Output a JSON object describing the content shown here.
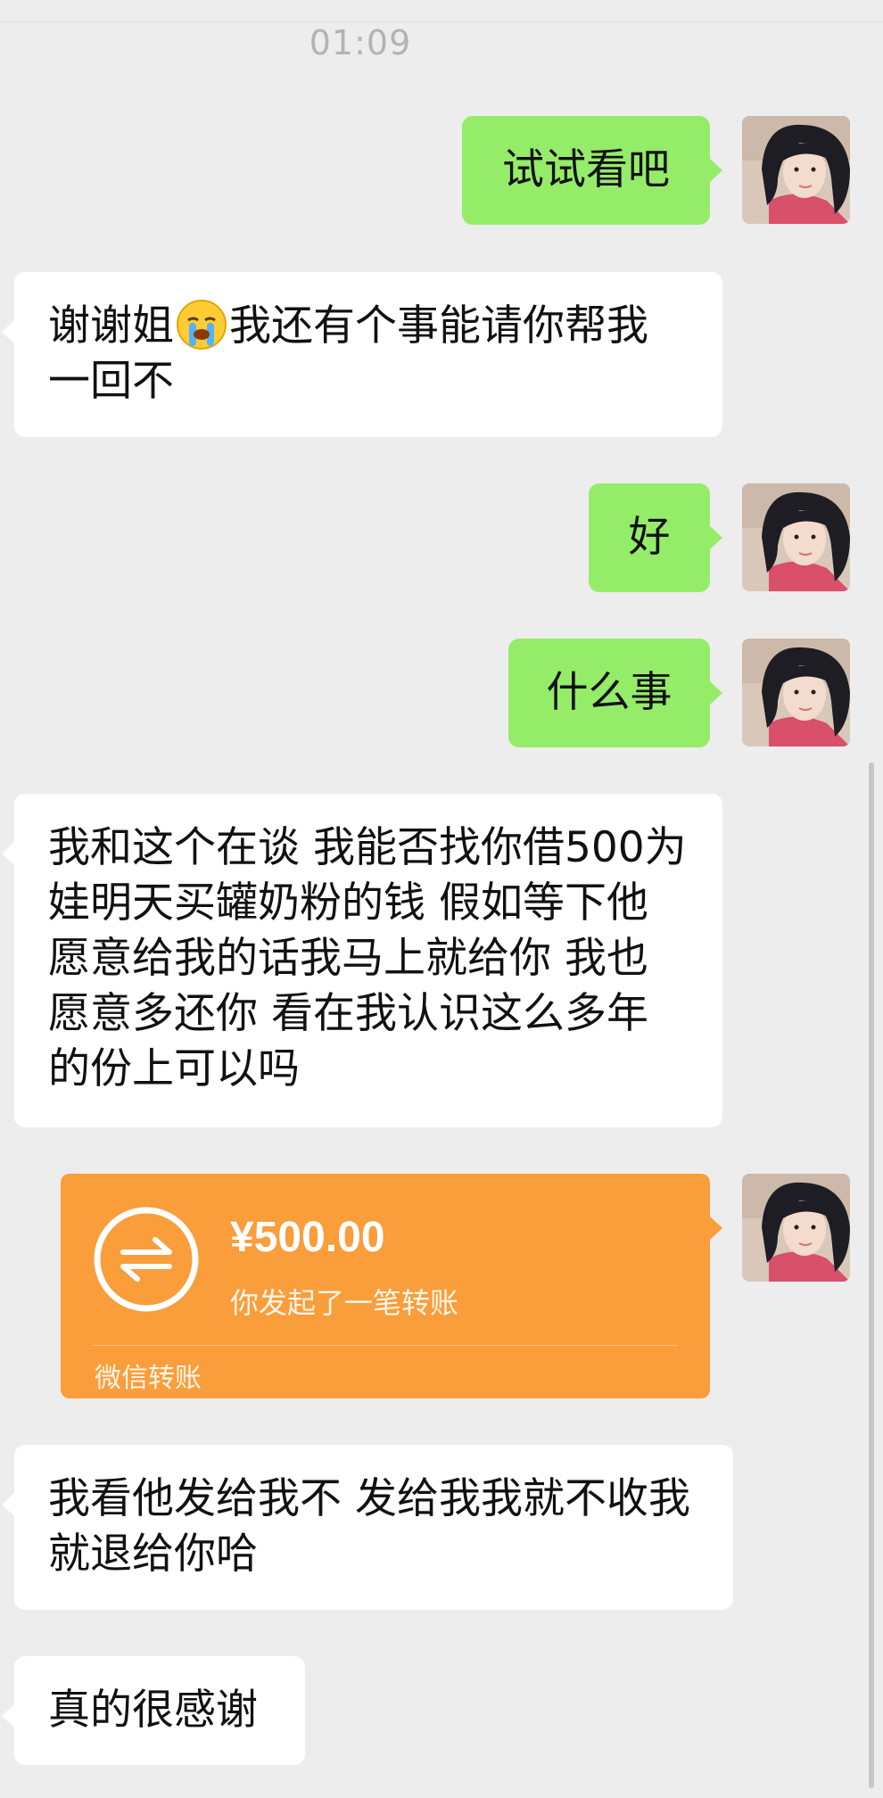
{
  "timestamp": "01:09",
  "messages": [
    {
      "side": "out",
      "text": "试试看吧"
    },
    {
      "side": "in",
      "text_before": "谢谢姐",
      "emoji": "crying-face-emoji",
      "text_after": "我还有个事能请你帮我一回不"
    },
    {
      "side": "out",
      "text": "好"
    },
    {
      "side": "out",
      "text": "什么事"
    },
    {
      "side": "in",
      "text": "我和这个在谈 我能否找你借500为娃明天买罐奶粉的钱 假如等下他愿意给我的话我马上就给你 我也愿意多还你 看在我认识这么多年的份上可以吗"
    },
    {
      "side": "in",
      "text": "我看他发给我不 发给我我就不收我就退给你哈"
    },
    {
      "side": "in",
      "text": "真的很感谢"
    }
  ],
  "transfer": {
    "amount": "¥500.00",
    "description": "你发起了一笔转账",
    "footer": "微信转账",
    "icon": "transfer-arrows-icon",
    "color": "#fa9d3b"
  },
  "colors": {
    "background": "#ededed",
    "outgoing_bubble": "#95ec69",
    "incoming_bubble": "#ffffff"
  }
}
